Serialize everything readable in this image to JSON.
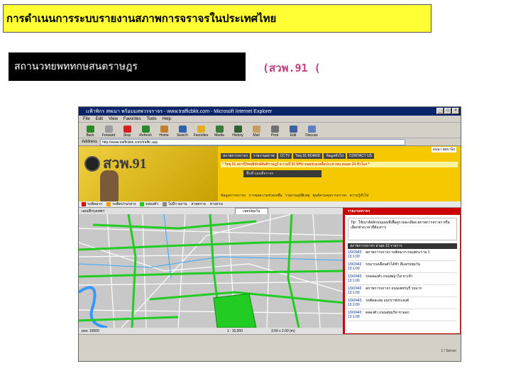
{
  "slide": {
    "title": "การดำเนนการระบบรายงานสภาพการจราจรในประเทศไทย",
    "station_name": "สถานวทยพททกษสนตราษฎร",
    "station_code": "(สวพ.91 ("
  },
  "browser": {
    "window_title": "เเฟ้าพิกร สพเมา พร้อมมสพวรจราจร - www.trafficbkk.com - Microsoft Internet Explorer",
    "menu": [
      "File",
      "Edit",
      "View",
      "Favorites",
      "Tools",
      "Help"
    ],
    "toolbar": [
      "Back",
      "Forward",
      "Stop",
      "Refresh",
      "Home",
      "Search",
      "Favorites",
      "Media",
      "History",
      "Mail",
      "Print",
      "Edit",
      "Discuss"
    ],
    "address_label": "Address",
    "address_value": "http://www.trafficbkk.com/traffic.asp",
    "window_buttons": [
      "_",
      "□",
      "×"
    ]
  },
  "site": {
    "logo_text": "สวพ.91",
    "corner_links": "อนน / สอบ Go",
    "nav": [
      "สภาพการจราจร",
      "รายงานสภาพ",
      "CCTV",
      "วิทยุ 91 BOARD",
      "ข้อมูลทั่วไป",
      "CONTACT US"
    ],
    "marquee": "* วิทยุ 91 สถานีวิทยุพิทักษ์สันติราษฎร์ ความถี่ 91 MHz คอยช่วยเหลือประชาชน ตลอด 24 ชั่วโมง *",
    "sub_box": "พื้นที่ แผนที่จราจร",
    "categories": [
      "ข้อมูลการจราจร",
      "การขอความช่วยเหลือ",
      "รายงานอุบัติเหตุ",
      "ศูนย์ควบคุมการจราจร",
      "ความรู้ทั่วไป"
    ]
  },
  "layers": [
    "รถติดมาก",
    "รถติดปานกลาง",
    "คล่องตัว",
    "ไม่มีรายงาน",
    "สายตรวจ",
    "ทางด่วน"
  ],
  "map": {
    "toolbar_label": "แผนที่กรุงเทพฯ",
    "select_value": "เขตปทุมวัน",
    "status_left": "pos: 10000",
    "status_scale": "1 : 15,000",
    "status_size": "3.50 x 2.00 (m)"
  },
  "info": {
    "header": "รายงานจราจร",
    "tip": "Tip : ใช้เมาส์คลิกบนแผนที่เพื่อดูรายละเอียด สภาพการจราจร หรือเลือกช่วงเวลาที่ต้องการ",
    "report_header": "สภาพการจราจร ล่าสุด 13 รายการ",
    "reports": [
      {
        "time": "1/9/2443 13:1:00",
        "text": "สภาพการจราจร รถติดมาก ถนนพระราม 1"
      },
      {
        "time": "1/9/2443 13:1:00",
        "text": "รถมากเคลื่อนตัวได้ช้า สี่แยกปทุมวัน"
      },
      {
        "time": "1/9/2443 13:1:00",
        "text": "รถคล่องตัว ถนนพญาไท ขาเข้า"
      },
      {
        "time": "1/9/2443 13:1:00",
        "text": "สภาพการจราจร ถนนเพชรบุรี รถมาก"
      },
      {
        "time": "1/9/2443 13:1:00",
        "text": "รถติดสะสม แยกราชประสงค์"
      },
      {
        "time": "1/9/2443 13:1:00",
        "text": "คล่องตัว ถนนสุขุมวิท ขาออก"
      }
    ],
    "footer": "1 / Server"
  },
  "colors": {
    "title_bg": "#ffff33",
    "station_bg": "#000000",
    "station_code": "#c04080",
    "road_green": "#22cc22",
    "map_bg": "#c8c8c8",
    "panel_red": "#cc0000"
  }
}
